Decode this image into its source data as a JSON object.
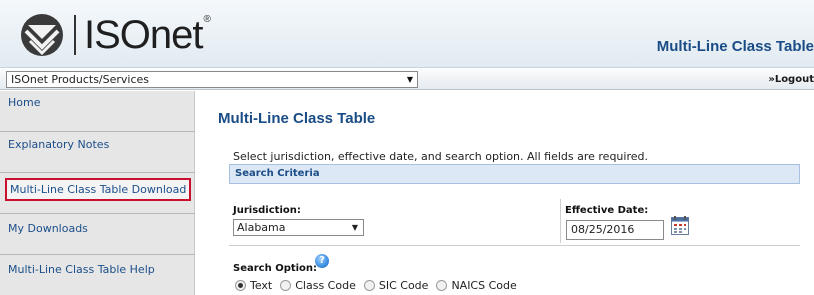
{
  "header": {
    "logo_text": "ISOnet",
    "logo_reg": "®",
    "app_title": "Multi-Line Class Table"
  },
  "topbar": {
    "products_select": "ISOnet Products/Services",
    "logout": "»Logout"
  },
  "sidebar": {
    "items": [
      {
        "label": "Home"
      },
      {
        "label": "Explanatory Notes"
      },
      {
        "label": "Multi-Line Class Table Download"
      },
      {
        "label": "My Downloads"
      },
      {
        "label": "Multi-Line Class Table Help"
      }
    ]
  },
  "main": {
    "title": "Multi-Line Class Table",
    "instructions": "Select jurisdiction, effective date, and search option. All fields are required.",
    "criteria_header": "Search Criteria",
    "jurisdiction_label": "Jurisdiction:",
    "jurisdiction_value": "Alabama",
    "effective_label": "Effective Date:",
    "effective_value": "08/25/2016",
    "search_option_label": "Search Option:",
    "search_options": [
      {
        "label": "Text",
        "selected": true
      },
      {
        "label": "Class Code",
        "selected": false
      },
      {
        "label": "SIC Code",
        "selected": false
      },
      {
        "label": "NAICS Code",
        "selected": false
      }
    ]
  }
}
